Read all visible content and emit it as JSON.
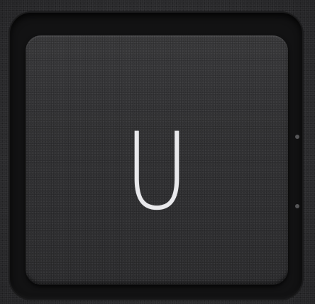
{
  "key": {
    "legend": "U"
  },
  "colors": {
    "background": "#2a2a2c",
    "keycap": "#353537",
    "legend": "#e9e9ec"
  }
}
